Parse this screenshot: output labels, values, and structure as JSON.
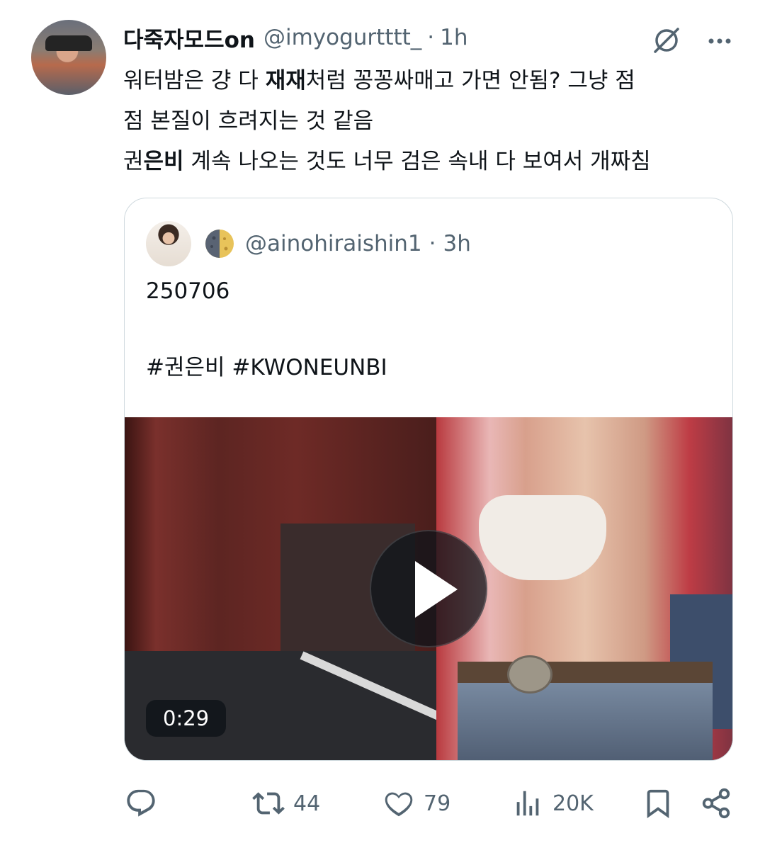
{
  "tweet": {
    "display_name": "다죽자모드on",
    "handle": "@imyogurtttt_",
    "separator": "·",
    "time": "1h",
    "text_lines": [
      {
        "before": "워터밤은 걍 다 ",
        "bold": "재재",
        "after": "처럼 꽁꽁싸매고 가면 안됨? 그냥 점"
      },
      {
        "before": "점 본질이 흐려지는 것 같음",
        "bold": "",
        "after": ""
      },
      {
        "before": "권",
        "bold": "은비",
        "after": " 계속 나오는 것도 너무 검은 속내 다 보여서 개짜침"
      }
    ]
  },
  "quote": {
    "handle": "@ainohiraishin1",
    "separator": "·",
    "time": "3h",
    "text_line1": "250706",
    "text_line2": "#권은비 #KWONEUNBI",
    "video": {
      "duration": "0:29"
    }
  },
  "actions": {
    "reply": {
      "icon": "reply-icon",
      "count": ""
    },
    "retweet": {
      "icon": "retweet-icon",
      "count": "44"
    },
    "like": {
      "icon": "heart-icon",
      "count": "79"
    },
    "views": {
      "icon": "views-icon",
      "count": "20K"
    },
    "bookmark": {
      "icon": "bookmark-icon",
      "count": ""
    },
    "share": {
      "icon": "share-icon",
      "count": ""
    }
  },
  "colors": {
    "text": "#0f1419",
    "secondary": "#536471",
    "border": "#cfd9de"
  }
}
